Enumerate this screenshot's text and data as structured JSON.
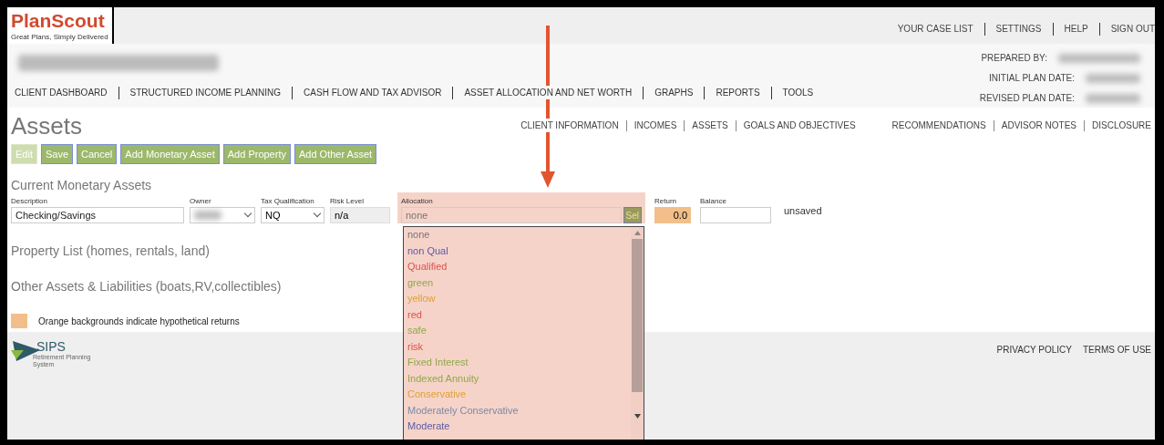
{
  "logo": {
    "name": "PlanScout",
    "tagline": "Great Plans, Simply Delivered"
  },
  "top_links": [
    "YOUR CASE LIST",
    "SETTINGS",
    "HELP",
    "SIGN OUT"
  ],
  "main_nav": [
    "CLIENT DASHBOARD",
    "STRUCTURED INCOME PLANNING",
    "CASH FLOW AND TAX ADVISOR",
    "ASSET ALLOCATION AND NET WORTH",
    "GRAPHS",
    "REPORTS",
    "TOOLS"
  ],
  "plan_info": [
    "PREPARED BY:",
    "INITIAL PLAN DATE:",
    "REVISED PLAN DATE:"
  ],
  "page_title": "Assets",
  "sub_nav_left": [
    "CLIENT INFORMATION",
    "INCOMES",
    "ASSETS",
    "GOALS AND OBJECTIVES"
  ],
  "sub_nav_right": [
    "RECOMMENDATIONS",
    "ADVISOR NOTES",
    "DISCLOSURE"
  ],
  "buttons": [
    {
      "label": "Edit",
      "disabled": true
    },
    {
      "label": "Save",
      "disabled": false
    },
    {
      "label": "Cancel",
      "disabled": false
    },
    {
      "label": "Add Monetary Asset",
      "disabled": false
    },
    {
      "label": "Add Property",
      "disabled": false
    },
    {
      "label": "Add Other Asset",
      "disabled": false
    }
  ],
  "monetary": {
    "heading": "Current Monetary Assets",
    "labels": {
      "description": "Description",
      "owner": "Owner",
      "tax": "Tax Qualification",
      "risk": "Risk Level",
      "allocation": "Allocation",
      "return": "Return",
      "balance": "Balance"
    },
    "description": "Checking/Savings",
    "tax": "NQ",
    "risk": "n/a",
    "allocation": "none",
    "select_button": "Sel",
    "return": "0.0",
    "return_hypothetical": true,
    "status": "unsaved"
  },
  "allocation_options": [
    {
      "label": "none",
      "color": "#777777"
    },
    {
      "label": "non Qual",
      "color": "#5b5ba8"
    },
    {
      "label": "Qualified",
      "color": "#d9534f"
    },
    {
      "label": "green",
      "color": "#8fa84a"
    },
    {
      "label": "yellow",
      "color": "#e0a030"
    },
    {
      "label": "red",
      "color": "#d9534f"
    },
    {
      "label": "safe",
      "color": "#8fa84a"
    },
    {
      "label": "risk",
      "color": "#d9534f"
    },
    {
      "label": "Fixed Interest",
      "color": "#8fa84a"
    },
    {
      "label": "Indexed Annuity",
      "color": "#8fa84a"
    },
    {
      "label": "Conservative",
      "color": "#e0a030"
    },
    {
      "label": "Moderately Conservative",
      "color": "#7a8aa8"
    },
    {
      "label": "Moderate",
      "color": "#5b5ba8"
    }
  ],
  "sections": [
    "Property List (homes, rentals, land)",
    "Other Assets & Liabilities (boats,RV,collectibles)"
  ],
  "legend": "Orange backgrounds indicate hypothetical returns",
  "footer": {
    "logo_name": "SIPS",
    "logo_sub": "Retirement Planning System",
    "links": [
      "PRIVACY POLICY",
      "TERMS OF USE"
    ]
  }
}
